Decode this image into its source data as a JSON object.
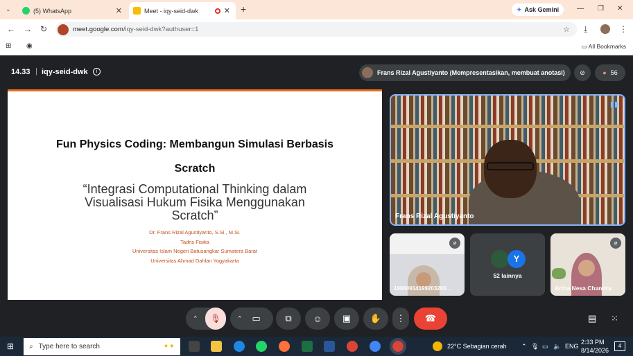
{
  "browser": {
    "tabs": [
      {
        "label": "(5) WhatsApp",
        "icon": "whatsapp-icon"
      },
      {
        "label": "Meet - iqy-seid-dwk",
        "icon": "meet-icon"
      }
    ],
    "gemini_label": "Ask Gemini",
    "url_host": "meet.google.com",
    "url_path": "/iqy-seid-dwk?authuser=1",
    "bookmarks_label": "All Bookmarks"
  },
  "meet": {
    "time": "14.33",
    "code": "iqy-seid-dwk",
    "presenter_label": "Frans Rizal Agustiyanto (Mempresentasikan, membuat anotasi)",
    "participant_count": "56",
    "slide": {
      "title_line1": "Fun Physics Coding: Membangun Simulasi Berbasis",
      "title_line2": "Scratch",
      "subtitle_line1": "“Integrasi Computational Thinking dalam",
      "subtitle_line2": "Visualisasi Hukum Fisika Menggunakan",
      "subtitle_line3": "Scratch”",
      "info_lines": [
        "Dr. Frans Rizal Agustiyanto, S.Si., M.Si.",
        "Tadris Fisika",
        "Universitas Islam Negeri Batusangkar Sumatera Barat",
        "Universitas Ahmad Dahlan Yogyakarta"
      ]
    },
    "tiles": {
      "main_name": "Frans Rizal Agustiyanto",
      "tile1_name": "19660914199203200...",
      "tile2_initial": "Y",
      "tile2_label": "52 lainnya",
      "tile3_name": "Artha Nesa Chandra"
    },
    "colors": {
      "end_call": "#ea4335",
      "mic_off": "#f9dedc",
      "slide_accent": "#e8711d"
    }
  },
  "taskbar": {
    "search_placeholder": "Type here to search",
    "weather": "22°C  Sebagian cerah",
    "lang": "ENG",
    "time": "2:33 PM",
    "date": "8/14/2026",
    "notifications": "4"
  }
}
